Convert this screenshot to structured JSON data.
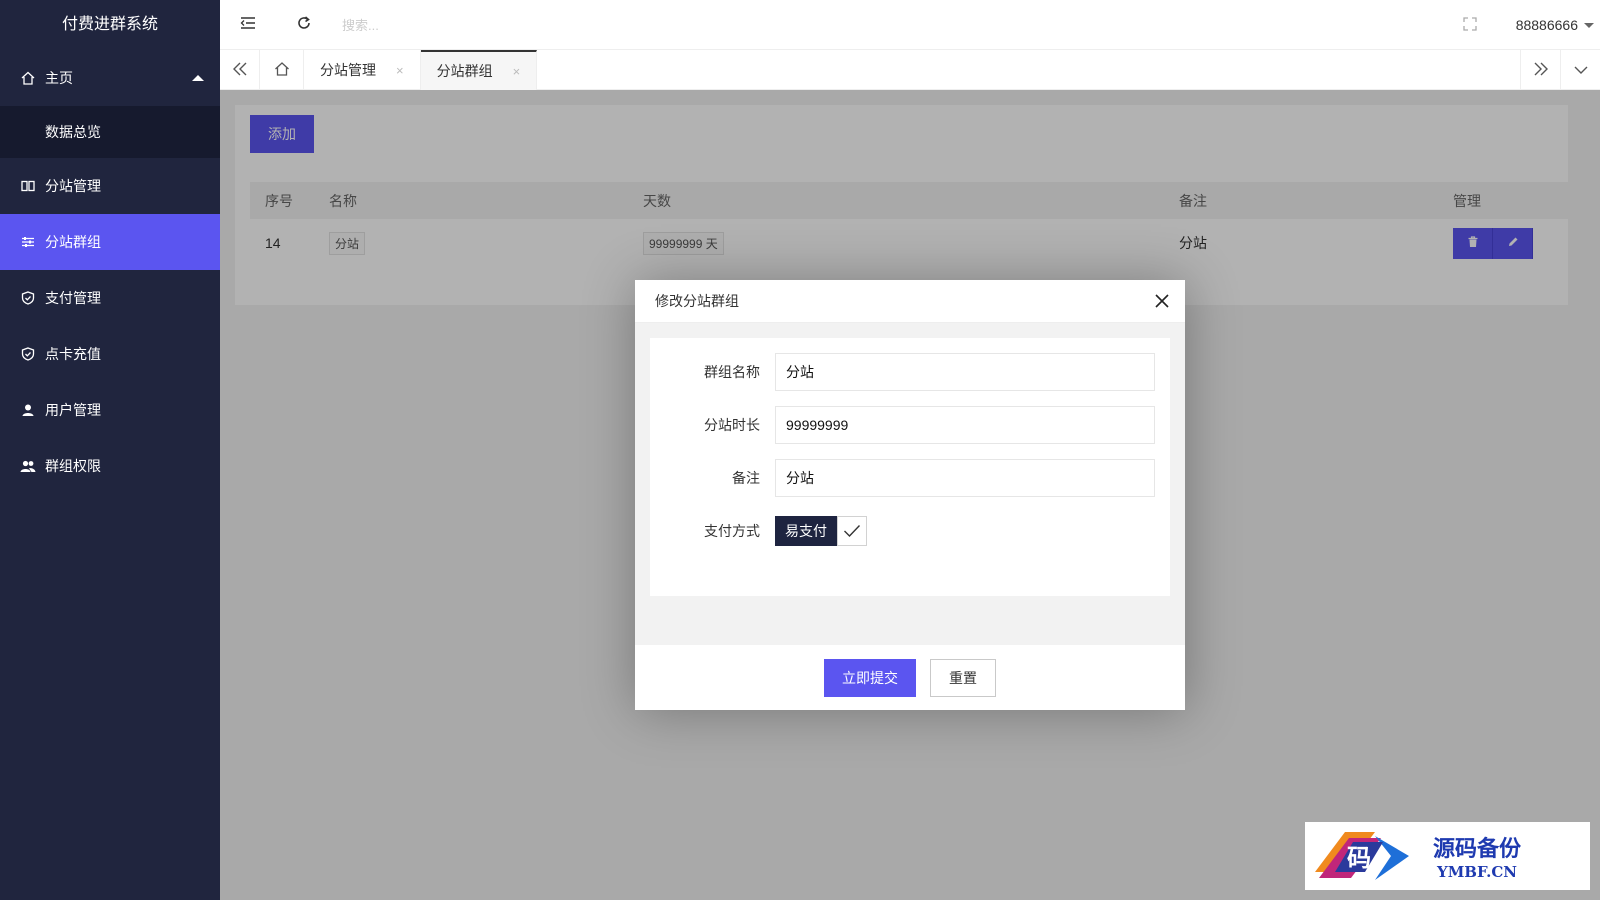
{
  "app": {
    "title": "付费进群系统"
  },
  "sidebar": {
    "home": {
      "label": "主页"
    },
    "sub_items": [
      {
        "label": "数据总览"
      }
    ],
    "items": [
      {
        "label": "分站管理",
        "icon": "columns-icon"
      },
      {
        "label": "分站群组",
        "icon": "sliders-icon",
        "active": true
      },
      {
        "label": "支付管理",
        "icon": "shield-check-icon"
      },
      {
        "label": "点卡充值",
        "icon": "shield-check-icon"
      },
      {
        "label": "用户管理",
        "icon": "user-icon"
      },
      {
        "label": "群组权限",
        "icon": "users-icon"
      }
    ]
  },
  "header": {
    "search_placeholder": "搜索...",
    "username": "88886666"
  },
  "tabs": [
    {
      "label": "分站管理",
      "close": "×"
    },
    {
      "label": "分站群组",
      "close": "×",
      "active": true
    }
  ],
  "main": {
    "add_label": "添加",
    "table": {
      "headers": [
        "序号",
        "名称",
        "天数",
        "备注",
        "管理"
      ],
      "rows": [
        {
          "id": "14",
          "name": "分站",
          "days": "99999999 天",
          "note": "分站"
        }
      ]
    }
  },
  "modal": {
    "title": "修改分站群组",
    "fields": {
      "group_name": {
        "label": "群组名称",
        "value": "分站"
      },
      "duration": {
        "label": "分站时长",
        "value": "99999999"
      },
      "note": {
        "label": "备注",
        "value": "分站"
      },
      "payment": {
        "label": "支付方式",
        "option": "易支付",
        "checked": true
      }
    },
    "submit_label": "立即提交",
    "reset_label": "重置"
  },
  "watermark": {
    "cn": "源码备份",
    "en": "YMBF.CN",
    "logo_char": "码"
  },
  "colors": {
    "sidebar": "#20253e",
    "accent": "#5b55f0",
    "sub_bg": "#161a2e"
  }
}
